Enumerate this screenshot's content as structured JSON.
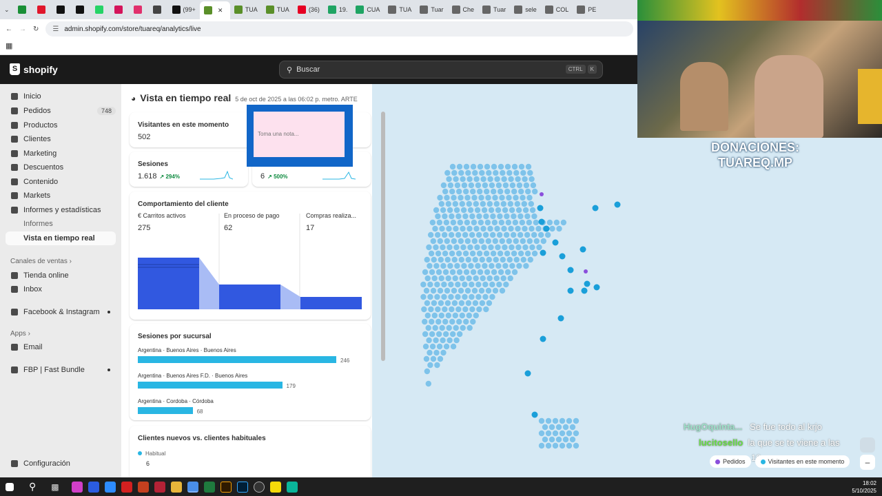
{
  "browser": {
    "tabs": [
      {
        "label": "",
        "color": "#1a8f36"
      },
      {
        "label": "",
        "color": "#e0162b"
      },
      {
        "label": "",
        "color": "#111111"
      },
      {
        "label": "",
        "color": "#111111"
      },
      {
        "label": "",
        "color": "#25d366"
      },
      {
        "label": "",
        "color": "#d4145a"
      },
      {
        "label": "",
        "color": "#e1306c"
      },
      {
        "label": "",
        "color": "#444444"
      },
      {
        "label": "(99+",
        "color": "#111111"
      },
      {
        "label": "",
        "color": "#5a8f29",
        "active": true
      },
      {
        "label": "TUA",
        "color": "#5a8f29"
      },
      {
        "label": "TUA",
        "color": "#5a8f29"
      },
      {
        "label": "(36)",
        "color": "#e60023"
      },
      {
        "label": "19.",
        "color": "#1fa463"
      },
      {
        "label": "CUA",
        "color": "#1fa463"
      },
      {
        "label": "TUA",
        "color": "#666666"
      },
      {
        "label": "Tuar",
        "color": "#666666"
      },
      {
        "label": "Che",
        "color": "#666666"
      },
      {
        "label": "Tuar",
        "color": "#666666"
      },
      {
        "label": "sele",
        "color": "#666666"
      },
      {
        "label": "COL",
        "color": "#666666"
      },
      {
        "label": "PE",
        "color": "#666666"
      }
    ],
    "url": "admin.shopify.com/store/tuareq/analytics/live"
  },
  "topbar": {
    "logo": "shopify",
    "search_placeholder": "Buscar",
    "kbd1": "CTRL",
    "kbd2": "K"
  },
  "sidebar": {
    "items": [
      {
        "label": "Inicio"
      },
      {
        "label": "Pedidos",
        "count": "748"
      },
      {
        "label": "Productos"
      },
      {
        "label": "Clientes"
      },
      {
        "label": "Marketing"
      },
      {
        "label": "Descuentos"
      },
      {
        "label": "Contenido"
      },
      {
        "label": "Markets"
      },
      {
        "label": "Informes y estadísticas"
      }
    ],
    "subitems": [
      {
        "label": "Informes"
      },
      {
        "label": "Vista en tiempo real"
      }
    ],
    "sales_channels_label": "Canales de ventas",
    "channels": [
      {
        "label": "Tienda online"
      },
      {
        "label": "Inbox"
      },
      {
        "label": "Facebook & Instagram"
      }
    ],
    "apps_label": "Apps",
    "apps": [
      {
        "label": "Email"
      },
      {
        "label": "FBP | Fast Bundle"
      }
    ],
    "settings_label": "Configuración"
  },
  "page": {
    "title": "Vista en tiempo real",
    "subtitle": "5 de oct de 2025 a las 06:02 p. metro. ARTE"
  },
  "visitors": {
    "label": "Visitantes en este momento",
    "value": "502"
  },
  "sessions": {
    "label": "Sesiones",
    "value": "1.618",
    "change": "294%"
  },
  "orders": {
    "label": "Pedidos",
    "value": "6",
    "change": "500%"
  },
  "note": {
    "placeholder": "Toma una nota..."
  },
  "behavior": {
    "title": "Comportamiento del cliente",
    "kpis": [
      {
        "label": "Carritos activos",
        "value": "275"
      },
      {
        "label": "En proceso de pago",
        "value": "62"
      },
      {
        "label": "Compras realiza...",
        "value": "17"
      }
    ],
    "chart_color": "#3158e0"
  },
  "branches": {
    "title": "Sesiones por sucursal",
    "rows": [
      {
        "label": "Argentina · Buenos Aires · Buenos Aires",
        "value": 246
      },
      {
        "label": "Argentina · Buenos Aires F.D. · Buenos Aires",
        "value": 179
      },
      {
        "label": "Argentina · Cordoba · Córdoba",
        "value": 68
      }
    ],
    "bar_color": "#29b6e3"
  },
  "clients": {
    "title": "Clientes nuevos vs. clientes habituales",
    "legend": "Habitual",
    "value": "6"
  },
  "stream": {
    "donations_line1": "DONACIONES:",
    "donations_line2": "TUAREQ.MP",
    "chat": [
      {
        "user": "HugOquinta...",
        "msg": "Se fue todo al krjo",
        "color": "#9ce0c8"
      },
      {
        "user": "lucitosello",
        "msg": "la que se te viene a las",
        "color": "#66dd44"
      }
    ],
    "chat_trail": "19"
  },
  "map_legend": [
    {
      "label": "Pedidos",
      "color": "#8a4fdc"
    },
    {
      "label": "Visitantes en este momento",
      "color": "#29b6e3"
    }
  ],
  "taskbar": {
    "time": "18:02",
    "date": "5/10/2025"
  }
}
